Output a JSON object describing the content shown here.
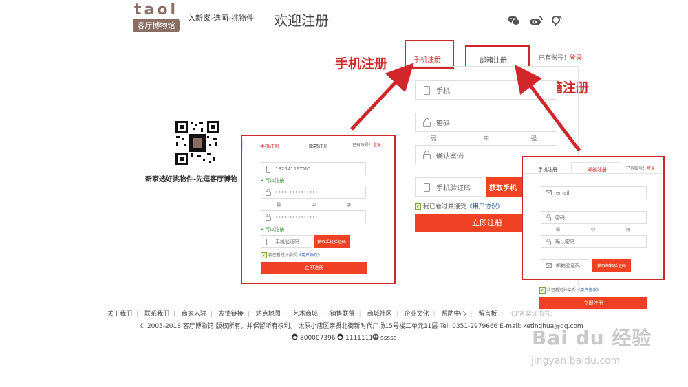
{
  "header": {
    "logo_top": "taol",
    "logo_bottom": "客厅博物馆",
    "slogan": "入新家-选画-挑物件",
    "welcome": "欢迎注册"
  },
  "annotations": {
    "phone_register": "手机注册",
    "email_register": "邮箱注册"
  },
  "main_form": {
    "tab_phone": "手机注册",
    "tab_email": "邮箱注册",
    "have_account": "已有账号！",
    "login": "登录",
    "phone_placeholder": "手机",
    "password_placeholder": "密码",
    "strength": [
      "弱",
      "中",
      "强"
    ],
    "confirm_placeholder": "确认密码",
    "sms_placeholder": "手机验证码",
    "get_code": "获取手机",
    "agree_prefix": "我已看过并接受",
    "agreement": "《用户协议》",
    "submit": "立即注册"
  },
  "qr": {
    "caption": "新家选好挑物件-先逛客厅博物"
  },
  "phone_card": {
    "tab_phone": "手机注册",
    "tab_email": "邮箱注册",
    "have_account": "已有账号！",
    "login": "登录",
    "phone_value": "1823411STMC",
    "can_register": "• 可以注册",
    "password_value": "•••••••••••••••",
    "strength": [
      "弱",
      "中",
      "强"
    ],
    "confirm_value": "•••••••••••••••",
    "can_register2": "• 可以注册",
    "sms_placeholder": "手机验证码",
    "get_code": "获取手机验证码",
    "agree_prefix": "我已看过并接受",
    "agreement": "《用户协议》",
    "submit": "立即注册"
  },
  "email_card": {
    "tab_phone": "手机注册",
    "tab_email": "邮箱注册",
    "have_account": "已有账号！",
    "login": "登录",
    "email_placeholder": "email",
    "password_placeholder": "密码",
    "strength": [
      "弱",
      "中",
      "强"
    ],
    "confirm_placeholder": "确认密码",
    "code_placeholder": "邮箱验证码",
    "get_code": "获取邮箱验证码",
    "agree_prefix": "我已看过并接受",
    "agreement": "《用户协议》",
    "submit": "立即注册"
  },
  "footer": {
    "links": [
      "关于我们",
      "联系我们",
      "商家入驻",
      "友情链接",
      "站点地图",
      "艺术商城",
      "销售联盟",
      "商城社区",
      "企业文化",
      "帮助中心",
      "留言板",
      "ICP备案证书号:"
    ],
    "copyright": "© 2005-2018 客厅博物馆 版权所有，并保留所有权利。 太原小店区亲贤北街新时代广场15号楼二单元11层 Tel: 0351-2979666 E-mail: ketinghua@qq.com",
    "qq": [
      "800007396",
      "1111111",
      "sssss"
    ]
  },
  "watermark": {
    "brand": "Bai du 经验",
    "url": "jingyan.baidu.com"
  },
  "colors": {
    "accent": "#d1272a",
    "button": "#f04124",
    "logo": "#8a6d63"
  }
}
